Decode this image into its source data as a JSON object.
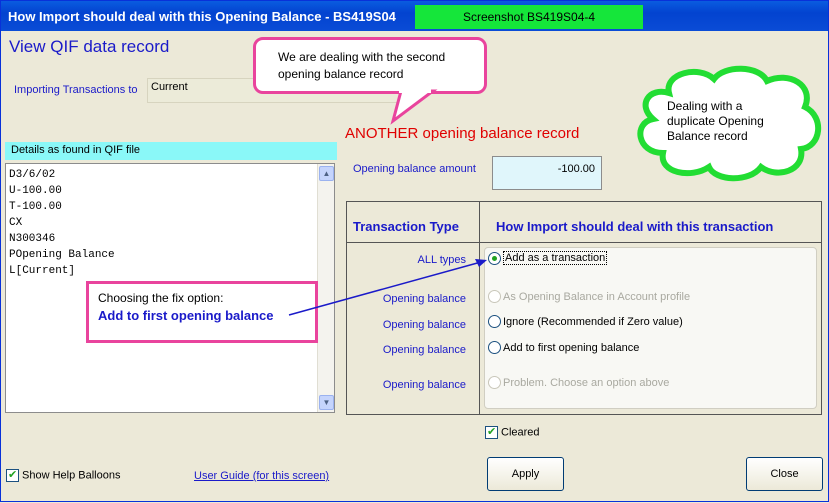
{
  "window": {
    "title": "How Import should deal with this Opening Balance - BS419S04",
    "screenshot_badge": "Screenshot BS419S04-4"
  },
  "heading": "View QIF data record",
  "importing": {
    "label": "Importing Transactions to",
    "value": "Current"
  },
  "callouts": {
    "top": [
      "We are dealing with the second",
      "opening balance record"
    ],
    "another": "ANOTHER opening balance record",
    "cloud": [
      "Dealing with a",
      "duplicate Opening",
      "Balance record"
    ],
    "fix_intro": "Choosing the fix option:",
    "fix_option": "Add to first opening balance"
  },
  "details": {
    "header": "Details as found in QIF file",
    "lines": [
      "D3/6/02",
      "U-100.00",
      "T-100.00",
      "CX",
      "N300346",
      "POpening Balance",
      "L[Current]"
    ]
  },
  "opening_balance": {
    "label": "Opening balance amount",
    "value": "-100.00"
  },
  "table": {
    "col_type": "Transaction Type",
    "col_how": "How Import should deal with this transaction",
    "rows": [
      {
        "type": "ALL types",
        "option": "Add as a transaction",
        "selected": true,
        "enabled": true
      },
      {
        "type": "Opening balance",
        "option": "As Opening Balance in Account profile",
        "selected": false,
        "enabled": false
      },
      {
        "type": "Opening balance",
        "option": "Ignore (Recommended if Zero value)",
        "selected": false,
        "enabled": true
      },
      {
        "type": "Opening balance",
        "option": "Add to first opening balance",
        "selected": false,
        "enabled": true
      },
      {
        "type": "Opening balance",
        "option": "Problem. Choose an option above",
        "selected": false,
        "enabled": false
      }
    ]
  },
  "cleared": {
    "label": "Cleared",
    "checked": true
  },
  "help_balloons": {
    "label": "Show Help Balloons",
    "checked": true
  },
  "user_guide": "User Guide (for this screen)",
  "buttons": {
    "apply": "Apply",
    "close": "Close"
  },
  "colors": {
    "accent_blue": "#1a1ac9",
    "highlight_red": "#e00000",
    "callout_border": "#e9449d",
    "badge_green": "#15e63a"
  }
}
